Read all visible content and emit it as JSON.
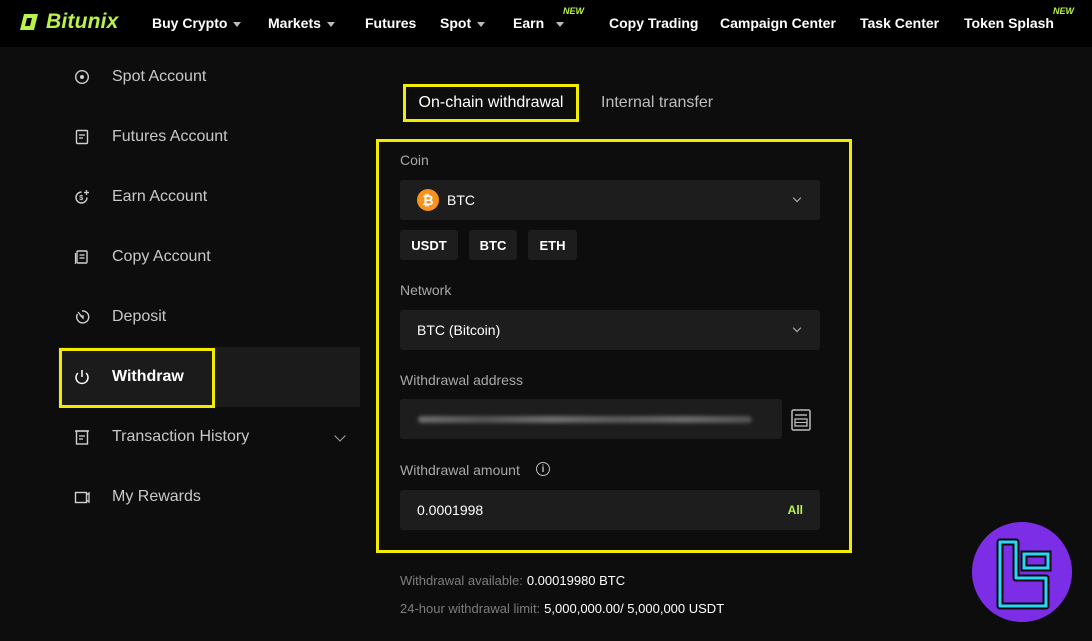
{
  "brand": {
    "name": "Bitunix",
    "accent": "#b8f24a"
  },
  "nav": {
    "items": [
      {
        "label": "Buy Crypto",
        "dropdown": true
      },
      {
        "label": "Markets",
        "dropdown": true
      },
      {
        "label": "Futures",
        "dropdown": false
      },
      {
        "label": "Spot",
        "dropdown": true
      },
      {
        "label": "Earn",
        "dropdown": true,
        "badge": "NEW"
      },
      {
        "label": "Copy Trading",
        "dropdown": false
      },
      {
        "label": "Campaign Center",
        "dropdown": false
      },
      {
        "label": "Task Center",
        "dropdown": false
      },
      {
        "label": "Token Splash",
        "dropdown": false,
        "badge": "NEW"
      }
    ]
  },
  "sidebar": {
    "items": [
      {
        "label": "Spot Account",
        "icon": "target-icon"
      },
      {
        "label": "Futures Account",
        "icon": "document-icon"
      },
      {
        "label": "Earn Account",
        "icon": "coin-plus-icon"
      },
      {
        "label": "Copy Account",
        "icon": "copy-icon"
      },
      {
        "label": "Deposit",
        "icon": "deposit-icon"
      },
      {
        "label": "Withdraw",
        "icon": "withdraw-icon",
        "active": true
      },
      {
        "label": "Transaction History",
        "icon": "history-icon",
        "expandable": true
      },
      {
        "label": "My Rewards",
        "icon": "rewards-icon"
      }
    ]
  },
  "tabs": {
    "active": "On-chain withdrawal",
    "other": "Internal transfer"
  },
  "form": {
    "coin_label": "Coin",
    "coin_value": "BTC",
    "coin_symbol": "₿",
    "quick_coins": [
      "USDT",
      "BTC",
      "ETH"
    ],
    "network_label": "Network",
    "network_value": "BTC (Bitcoin)",
    "address_label": "Withdrawal address",
    "amount_label": "Withdrawal amount",
    "amount_value": "0.0001998",
    "all_label": "All"
  },
  "limits": {
    "available_label": "Withdrawal available:",
    "available_value": "0.00019980 BTC",
    "limit_label": "24-hour withdrawal limit:",
    "limit_value": "5,000,000.00/ 5,000,000 USDT"
  },
  "colors": {
    "highlight": "#f2ec00",
    "coin": "#f7931a",
    "badge": "#7b2ee6",
    "badge_accent": "#29d6f5"
  }
}
